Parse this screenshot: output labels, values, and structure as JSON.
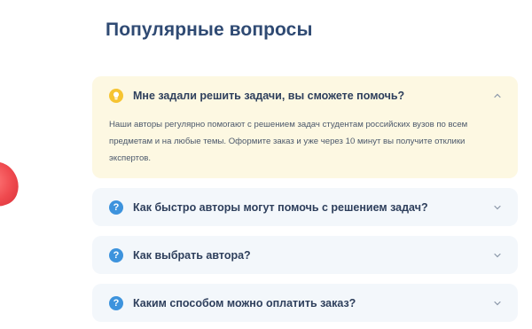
{
  "section": {
    "title": "Популярные вопросы"
  },
  "faq": [
    {
      "question": "Мне задали решить задачи, вы сможете помочь?",
      "answer": "Наши авторы регулярно помогают с решением задач студентам российских вузов по всем предметам и на любые темы. Оформите заказ и уже через 10 минут вы получите отклики экспертов.",
      "expanded": true,
      "icon": "lightbulb-icon"
    },
    {
      "question": "Как быстро авторы могут помочь с решением задач?",
      "expanded": false,
      "icon": "question-icon"
    },
    {
      "question": "Как выбрать автора?",
      "expanded": false,
      "icon": "question-icon"
    },
    {
      "question": "Каким способом можно оплатить заказ?",
      "expanded": false,
      "icon": "question-icon"
    }
  ],
  "icons": {
    "question_glyph": "?"
  },
  "colors": {
    "title": "#2f4a73",
    "accent_blue": "#3d93dd",
    "bulb_yellow": "#f6c431",
    "open_item_bg": "#fdf8e2",
    "item_bg": "#f3f7fb"
  }
}
